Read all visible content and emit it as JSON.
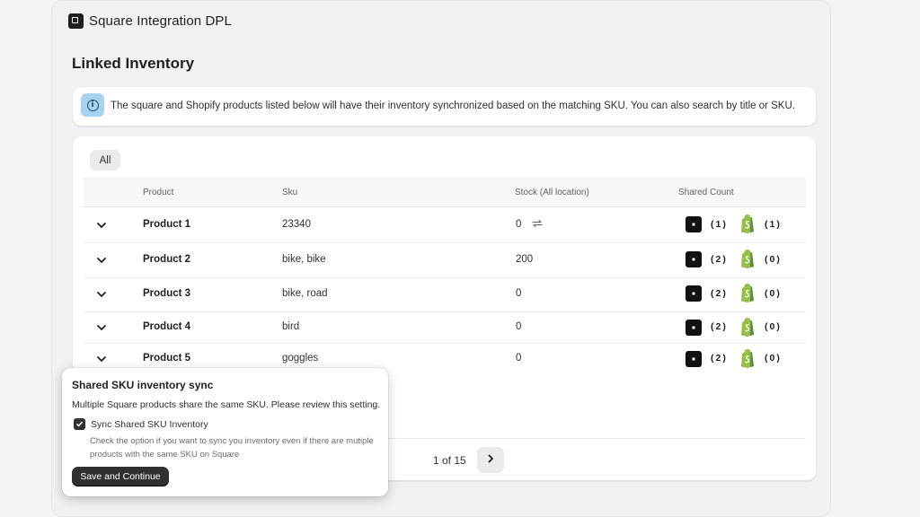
{
  "app": {
    "title": "Square Integration DPL",
    "logo_icon": "app-logo-icon"
  },
  "page": {
    "title": "Linked Inventory"
  },
  "banner": {
    "icon": "info-icon",
    "text": "The square and Shopify products listed below will have their inventory synchronized based on the matching SKU. You can also search by title or SKU."
  },
  "filters": {
    "all_label": "All"
  },
  "table": {
    "headers": {
      "product": "Product",
      "sku": "Sku",
      "stock": "Stock (All location)",
      "shared": "Shared Count"
    },
    "rows": [
      {
        "product": "Product 1",
        "sku": "23340",
        "stock": "0",
        "square_count": "(1)",
        "shopify_count": "(1)",
        "sync_icon": true
      },
      {
        "product": "Product 2",
        "sku": "bike, bike",
        "stock": "200",
        "square_count": "(2)",
        "shopify_count": "(0)",
        "sync_icon": false
      },
      {
        "product": "Product 3",
        "sku": "bike, road",
        "stock": "0",
        "square_count": "(2)",
        "shopify_count": "(0)",
        "sync_icon": false
      },
      {
        "product": "Product 4",
        "sku": "bird",
        "stock": "0",
        "square_count": "(2)",
        "shopify_count": "(0)",
        "sync_icon": false
      },
      {
        "product": "Product 5",
        "sku": "goggles",
        "stock": "0",
        "square_count": "(2)",
        "shopify_count": "(0)",
        "sync_icon": false
      }
    ]
  },
  "pagination": {
    "text": "1 of 15"
  },
  "popover": {
    "title": "Shared SKU inventory sync",
    "description": "Multiple Square products share the same SKU. Please review this setting.",
    "checkbox_label": "Sync Shared SKU Inventory",
    "checkbox_checked": true,
    "help_text": "Check the option if you want to sync you inventory even if there are mutiple products with the same SKU on Square",
    "save_label": "Save and Continue"
  },
  "colors": {
    "accent_dark": "#303030",
    "info_bg": "#a7d3f2",
    "shopify_green": "#95bf47"
  }
}
